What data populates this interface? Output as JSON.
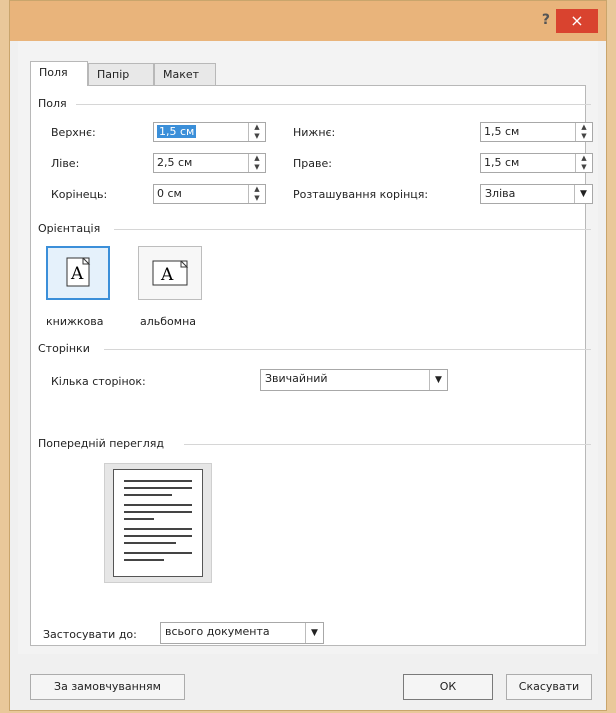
{
  "titlebar": {
    "help_label": "?",
    "close_label": "×"
  },
  "tabs": [
    "Поля",
    "Папір",
    "Макет"
  ],
  "margins": {
    "section_label": "Поля",
    "top_label": "Верхнє:",
    "top_value": "1,5 см",
    "bottom_label": "Нижнє:",
    "bottom_value": "1,5 см",
    "left_label": "Ліве:",
    "left_value": "2,5 см",
    "right_label": "Праве:",
    "right_value": "1,5 см",
    "gutter_label": "Корінець:",
    "gutter_value": "0 см",
    "gutter_pos_label": "Розташування корінця:",
    "gutter_pos_value": "Зліва"
  },
  "orientation": {
    "section_label": "Орієнтація",
    "portrait_label": "книжкова",
    "landscape_label": "альбомна",
    "icon_letter": "A"
  },
  "pages": {
    "section_label": "Сторінки",
    "multiple_label": "Кілька сторінок:",
    "multiple_value": "Звичайний"
  },
  "preview": {
    "section_label": "Попередній перегляд"
  },
  "apply": {
    "label": "Застосувати до:",
    "value": "всього документа"
  },
  "buttons": {
    "default_label": "За замовчуванням",
    "ok_label": "ОК",
    "cancel_label": "Скасувати"
  },
  "colors": {
    "titlebar": "#e9b47b",
    "close": "#d9432f",
    "selection": "#3b8fd9"
  }
}
